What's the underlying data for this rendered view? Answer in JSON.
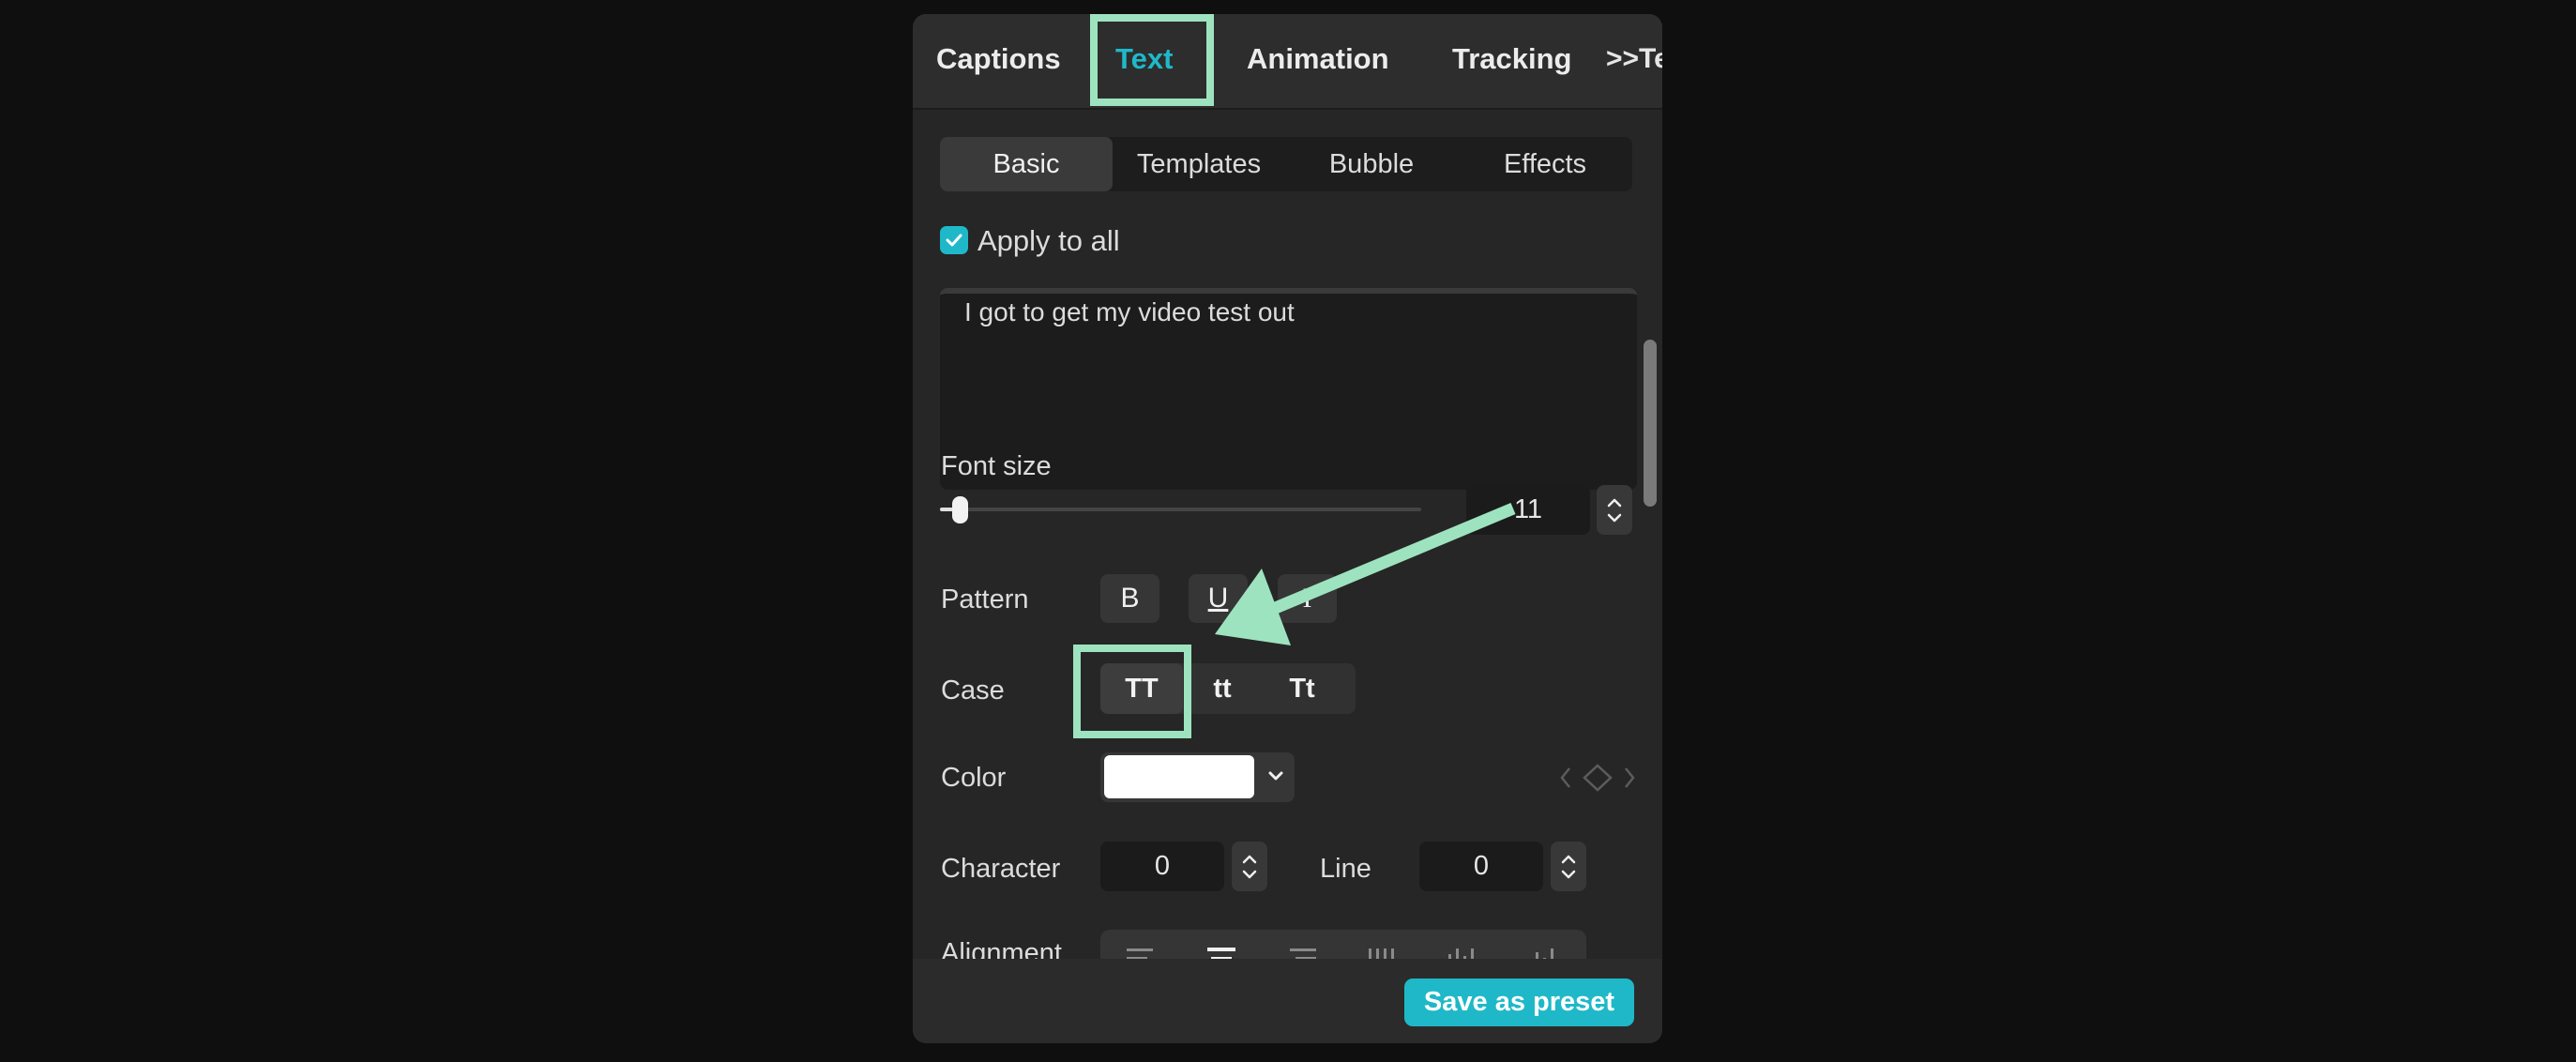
{
  "tabs": [
    {
      "label": "Captions",
      "active": false
    },
    {
      "label": "Text",
      "active": true
    },
    {
      "label": "Animation",
      "active": false
    },
    {
      "label": "Tracking",
      "active": false
    }
  ],
  "tab_overflow": {
    "label": ">>Te"
  },
  "subtabs": [
    {
      "label": "Basic",
      "active": true
    },
    {
      "label": "Templates",
      "active": false
    },
    {
      "label": "Bubble",
      "active": false
    },
    {
      "label": "Effects",
      "active": false
    }
  ],
  "apply_to_all": {
    "label": "Apply to all",
    "checked": true
  },
  "text_content": "I got to get my video test out",
  "font_size": {
    "label": "Font size",
    "value": "11",
    "slider_fraction": 0.03
  },
  "pattern": {
    "label": "Pattern",
    "buttons": [
      "B",
      "U",
      "I"
    ]
  },
  "case": {
    "label": "Case",
    "options": [
      "TT",
      "tt",
      "Tt"
    ],
    "selected": "TT"
  },
  "color": {
    "label": "Color",
    "value": "#ffffff"
  },
  "spacing": {
    "character": {
      "label": "Character",
      "value": "0"
    },
    "line": {
      "label": "Line",
      "value": "0"
    }
  },
  "alignment": {
    "label": "Alignment",
    "options": [
      "align-left",
      "align-center",
      "align-right",
      "distribute-vertical",
      "vertical-center",
      "vertical-bottom"
    ],
    "selected": "align-center"
  },
  "footer": {
    "save_label": "Save as preset"
  },
  "colors": {
    "accent": "#1fb8c8",
    "annotation": "#9de3bf",
    "panel": "#262626",
    "background": "#0f0f0f"
  }
}
